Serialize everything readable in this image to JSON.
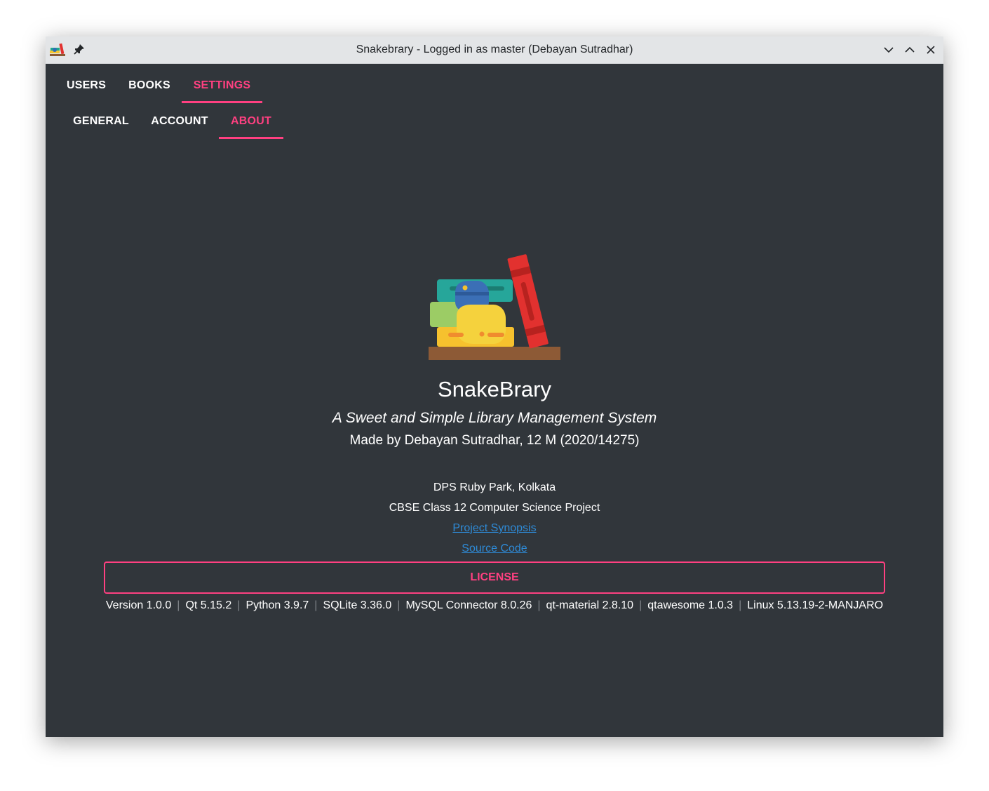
{
  "window": {
    "title": "Snakebrary - Logged in as master (Debayan Sutradhar)",
    "icons": [
      "app-icon",
      "pin-icon",
      "minimize-icon",
      "maximize-icon",
      "close-icon"
    ]
  },
  "main_tabs": [
    {
      "label": "USERS",
      "active": false
    },
    {
      "label": "BOOKS",
      "active": false
    },
    {
      "label": "SETTINGS",
      "active": true
    }
  ],
  "sub_tabs": [
    {
      "label": "GENERAL",
      "active": false
    },
    {
      "label": "ACCOUNT",
      "active": false
    },
    {
      "label": "ABOUT",
      "active": true
    }
  ],
  "about": {
    "name": "SnakeBrary",
    "tagline": "A Sweet and Simple Library Management System",
    "author": "Made by Debayan Sutradhar, 12 M (2020/14275)",
    "school": "DPS Ruby Park, Kolkata",
    "project": "CBSE Class 12 Computer Science Project",
    "synopsis_link": "Project Synopsis",
    "source_link": "Source Code",
    "license_button": "LICENSE",
    "versions": [
      "Version 1.0.0",
      "Qt 5.15.2",
      "Python 3.9.7",
      "SQLite 3.36.0",
      "MySQL Connector 8.0.26",
      "qt-material 2.8.10",
      "qtawesome 1.0.3",
      "Linux 5.13.19-2-MANJARO"
    ],
    "separator": "|"
  },
  "colors": {
    "accent": "#ff4081",
    "background": "#31363b",
    "titlebar": "#e3e5e7",
    "link": "#2e8ad6",
    "text": "#ffffff"
  }
}
